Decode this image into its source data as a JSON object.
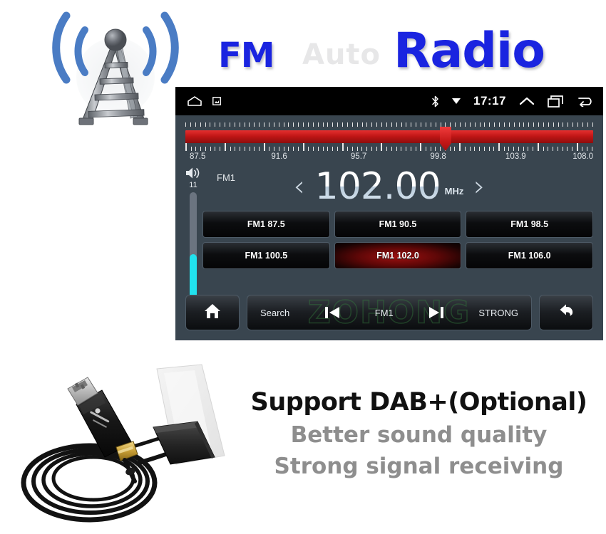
{
  "header": {
    "word_fm": "FM",
    "word_radio": "Radio",
    "ghost_word": "Auto"
  },
  "status_bar": {
    "home_icon": "home-icon",
    "screenshot_icon": "screenshot-icon",
    "bluetooth_icon": "bluetooth-icon",
    "dropdown_icon": "caret-down-icon",
    "clock": "17:17",
    "expand_icon": "chevron-up-icon",
    "recents_icon": "recents-icon",
    "back_icon": "back-arrow-icon"
  },
  "tuner": {
    "scale_labels": [
      "87.5",
      "91.6",
      "95.7",
      "99.8",
      "103.9",
      "108.0"
    ],
    "scale_positions": [
      3.0,
      23.0,
      42.5,
      62.0,
      81.0,
      97.5
    ],
    "pointer_percent": 63.8,
    "range_min": "87.5",
    "range_max": "108.0"
  },
  "volume": {
    "icon": "speaker-volume-icon",
    "level": "11",
    "fill_percent": 42
  },
  "radio": {
    "band": "FM1",
    "frequency": "102.00",
    "unit": "MHz",
    "prev_chevron": "‹",
    "next_chevron": "›"
  },
  "presets": [
    {
      "label": "FM1 87.5",
      "active": false
    },
    {
      "label": "FM1 90.5",
      "active": false
    },
    {
      "label": "FM1 98.5",
      "active": false
    },
    {
      "label": "FM1 100.5",
      "active": false
    },
    {
      "label": "FM1 102.0",
      "active": true
    },
    {
      "label": "FM1 106.0",
      "active": false
    }
  ],
  "toolbar": {
    "home_icon": "home-icon",
    "search_label": "Search",
    "prev_icon": "skip-previous-icon",
    "band_label": "FM1",
    "next_icon": "skip-next-icon",
    "strong_label": "STRONG",
    "back_icon": "back-arrow-icon",
    "watermark": "ZOHONG"
  },
  "marketing": {
    "headline": "Support DAB+(Optional)",
    "line_1": "Better sound quality",
    "line_2": "Strong signal receiving"
  },
  "colors": {
    "screen_bg": "#39454f",
    "status_bar_bg": "#000000",
    "tuner_red": "#c11616",
    "volume_cyan": "#21e2ee",
    "title_blue": "#1a24e0",
    "preset_active_red": "#9e1010",
    "marketing_gray": "#8e8e8e",
    "tower_gray": "#7c8086",
    "signal_blue": "#4a7cc4"
  }
}
